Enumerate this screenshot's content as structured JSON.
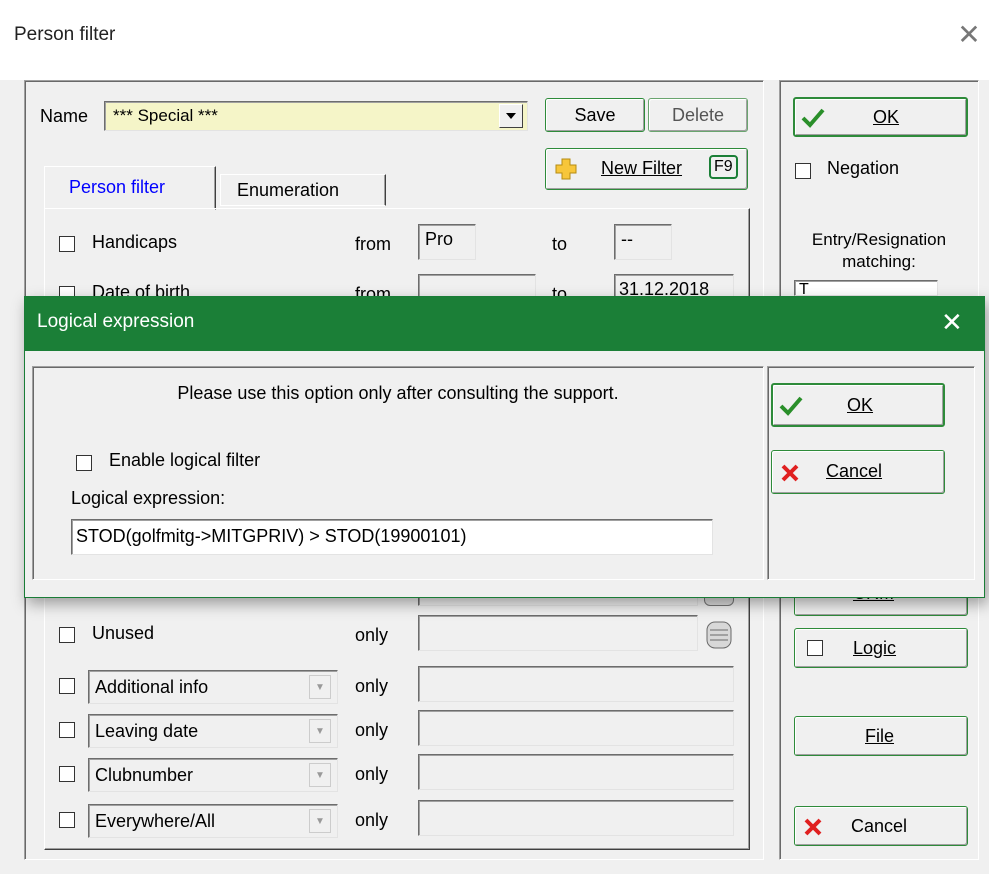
{
  "window": {
    "title": "Person filter",
    "close_glyph": "✕"
  },
  "name_row": {
    "label": "Name",
    "value": "*** Special ***"
  },
  "buttons": {
    "save": "Save",
    "delete": "Delete",
    "new_filter": "New Filter",
    "new_filter_key": "F9",
    "ok": "OK",
    "crm": "CRM",
    "logic": "Logic",
    "file": "File",
    "cancel": "Cancel"
  },
  "tabs": [
    {
      "label": "Person filter"
    },
    {
      "label": "Enumeration"
    }
  ],
  "rows": {
    "handicaps": {
      "label": "Handicaps",
      "from_label": "from",
      "from_value": "Pro",
      "to_label": "to",
      "to_value": "--"
    },
    "date_of_birth": {
      "label": "Date of birth",
      "from_label": "from",
      "from_value": "",
      "to_label": "to",
      "to_value": "31.12.2018"
    },
    "unused": {
      "label": "Unused",
      "only_label": "only",
      "value": ""
    },
    "combo_rows": [
      {
        "select": "Additional info",
        "only_label": "only",
        "value": ""
      },
      {
        "select": "Leaving date",
        "only_label": "only",
        "value": ""
      },
      {
        "select": "Clubnumber",
        "only_label": "only",
        "value": ""
      },
      {
        "select": "Everywhere/All",
        "only_label": "only",
        "value": ""
      }
    ]
  },
  "side": {
    "negation_label": "Negation",
    "entry_label_1": "Entry/Resignation",
    "entry_label_2": "matching:",
    "entry_value": "T"
  },
  "dialog": {
    "title": "Logical expression",
    "close_glyph": "✕",
    "notice": "Please use this option only after consulting the support.",
    "enable_label": "Enable logical filter",
    "expression_label": "Logical expression:",
    "expression_value": "STOD(golfmitg->MITGPRIV) > STOD(19900101)",
    "ok": "OK",
    "cancel": "Cancel"
  },
  "colors": {
    "accent_green": "#1b7f37",
    "name_field_bg": "#f5f5c8",
    "tab_active_text": "#0000ff"
  }
}
